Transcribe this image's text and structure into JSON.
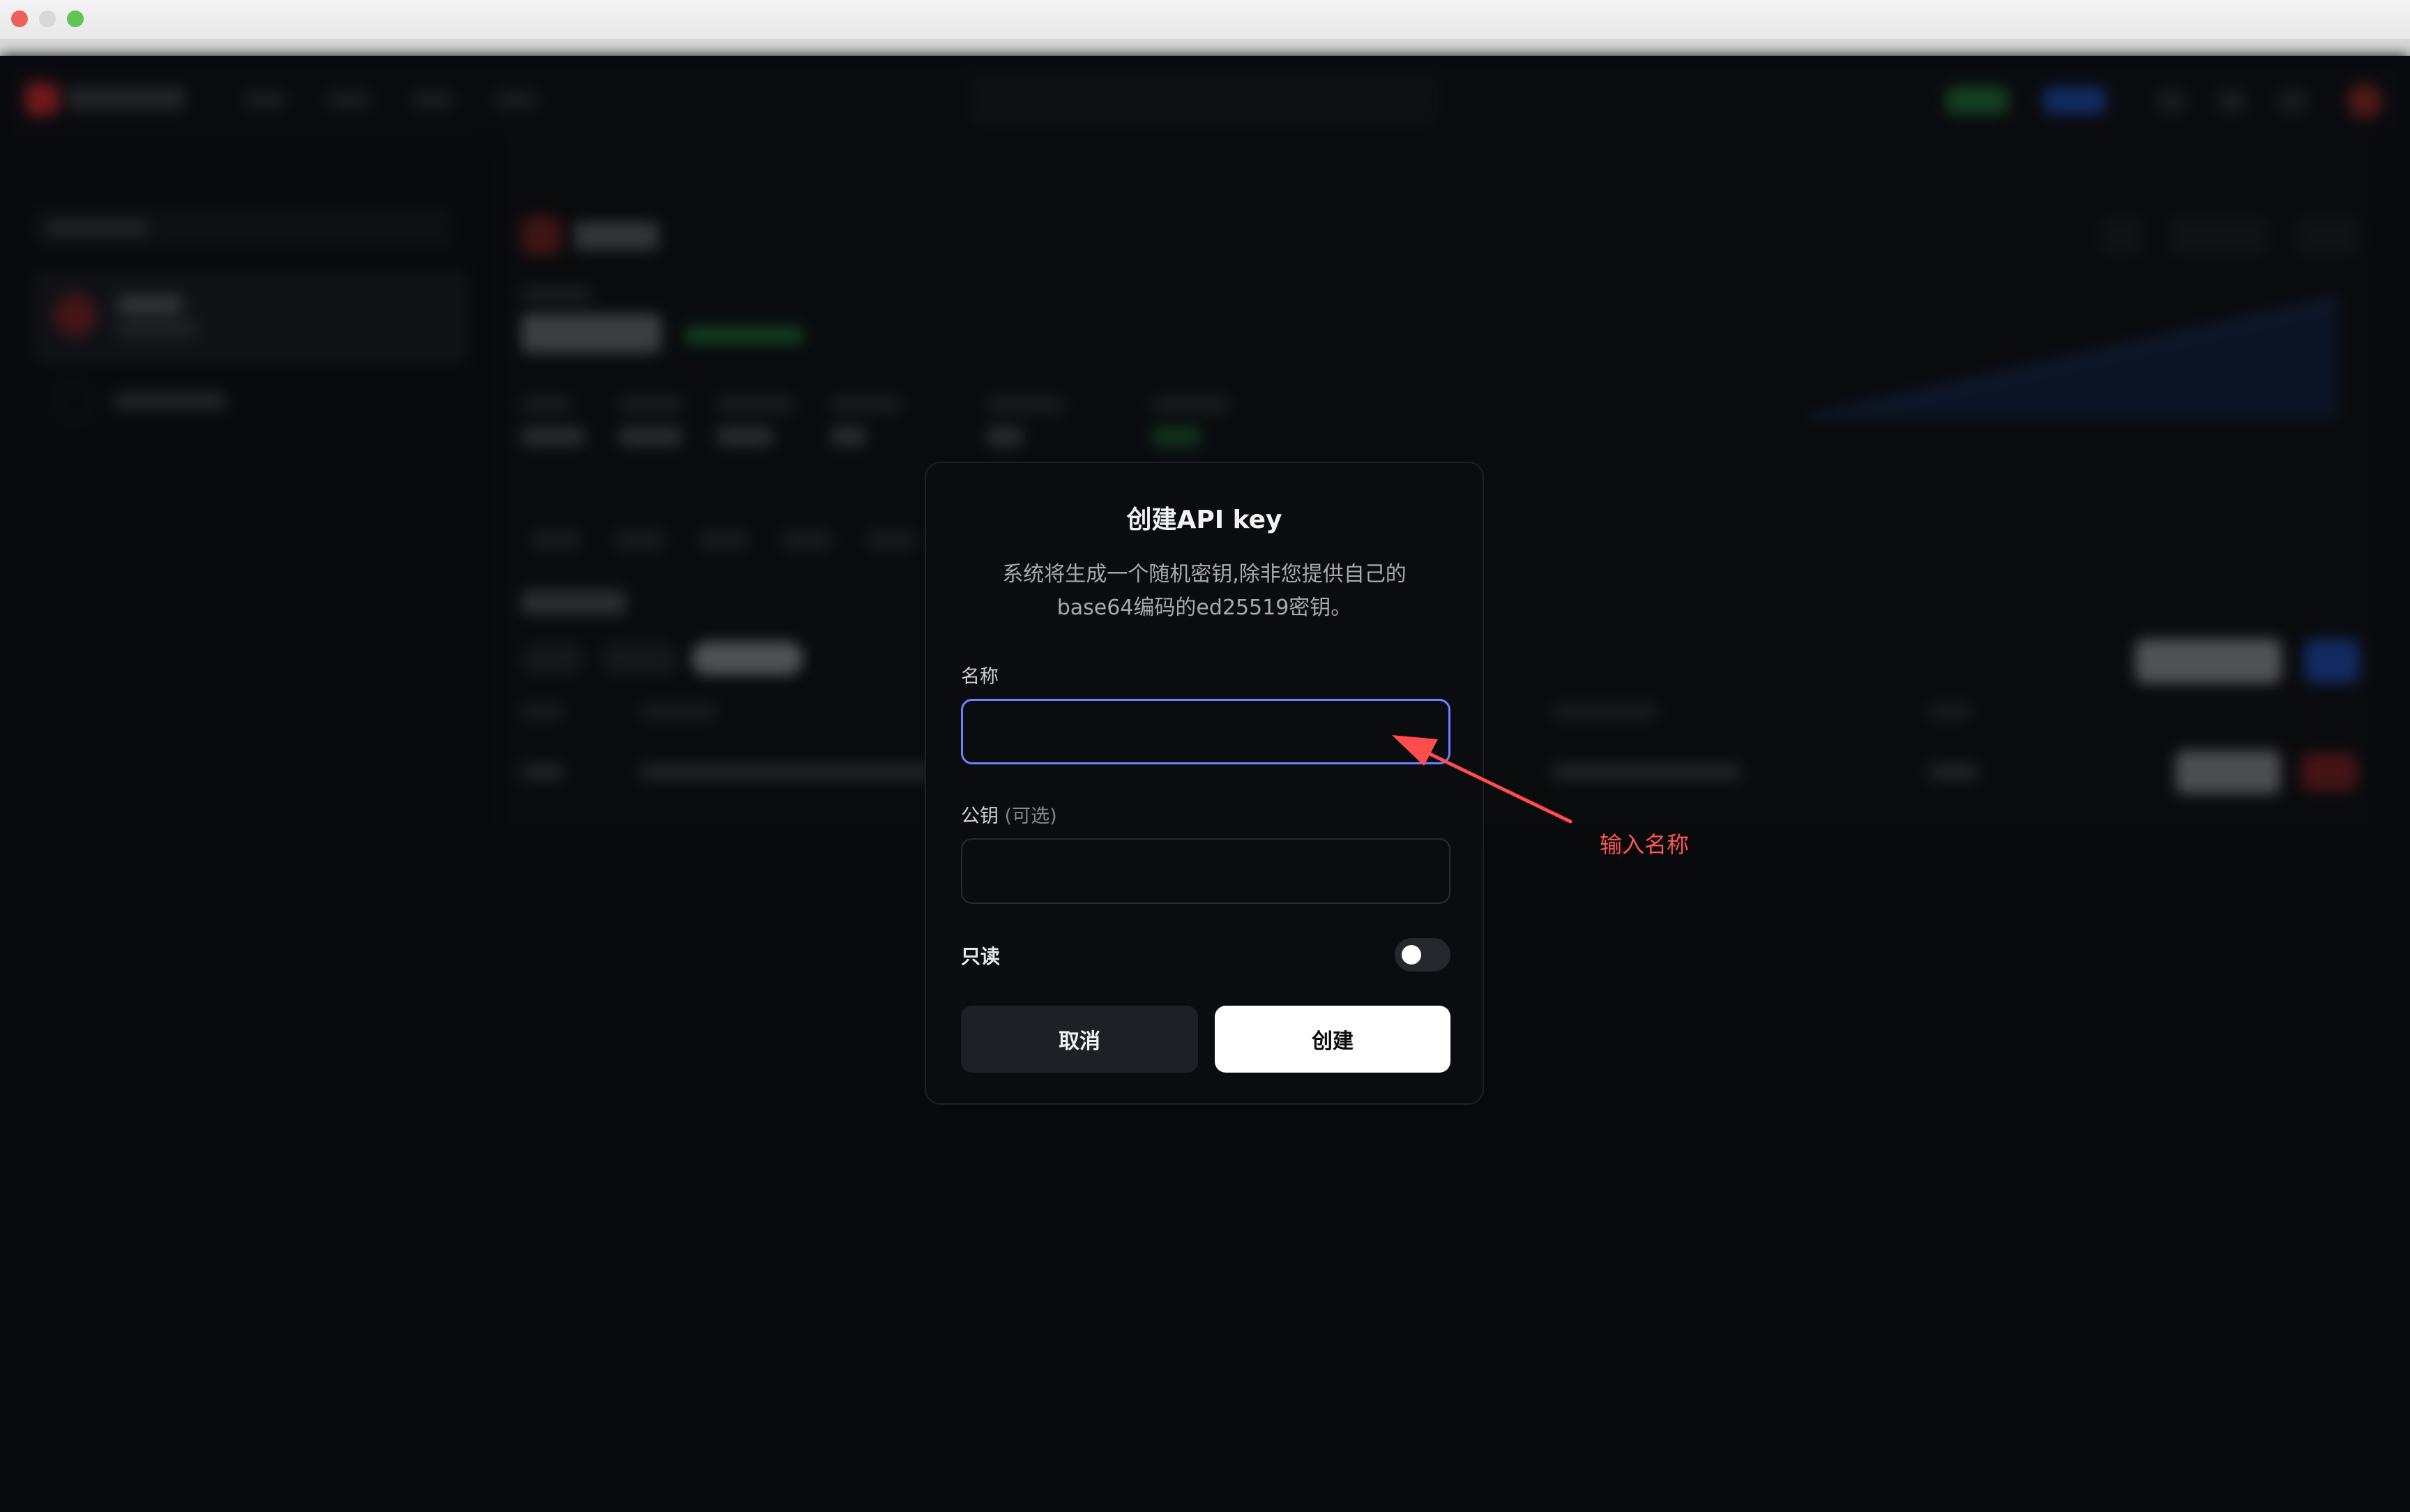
{
  "window": {
    "controls": [
      "close",
      "minimize",
      "maximize"
    ]
  },
  "dialog": {
    "title": "创建API key",
    "description": "系统将生成一个随机密钥,除非您提供自己的base64编码的ed25519密钥。",
    "name_label": "名称",
    "name_value": "",
    "public_key_label": "公钥",
    "public_key_optional": "(可选)",
    "public_key_value": "",
    "readonly_label": "只读",
    "readonly_enabled": false,
    "cancel_label": "取消",
    "create_label": "创建"
  },
  "annotation": {
    "text": "输入名称",
    "color": "#ff4d4d"
  },
  "colors": {
    "background": "#0b0c0f",
    "input_focus_border": "#6c82ff",
    "primary_button": "#ffffff",
    "secondary_button": "#1f2025"
  }
}
